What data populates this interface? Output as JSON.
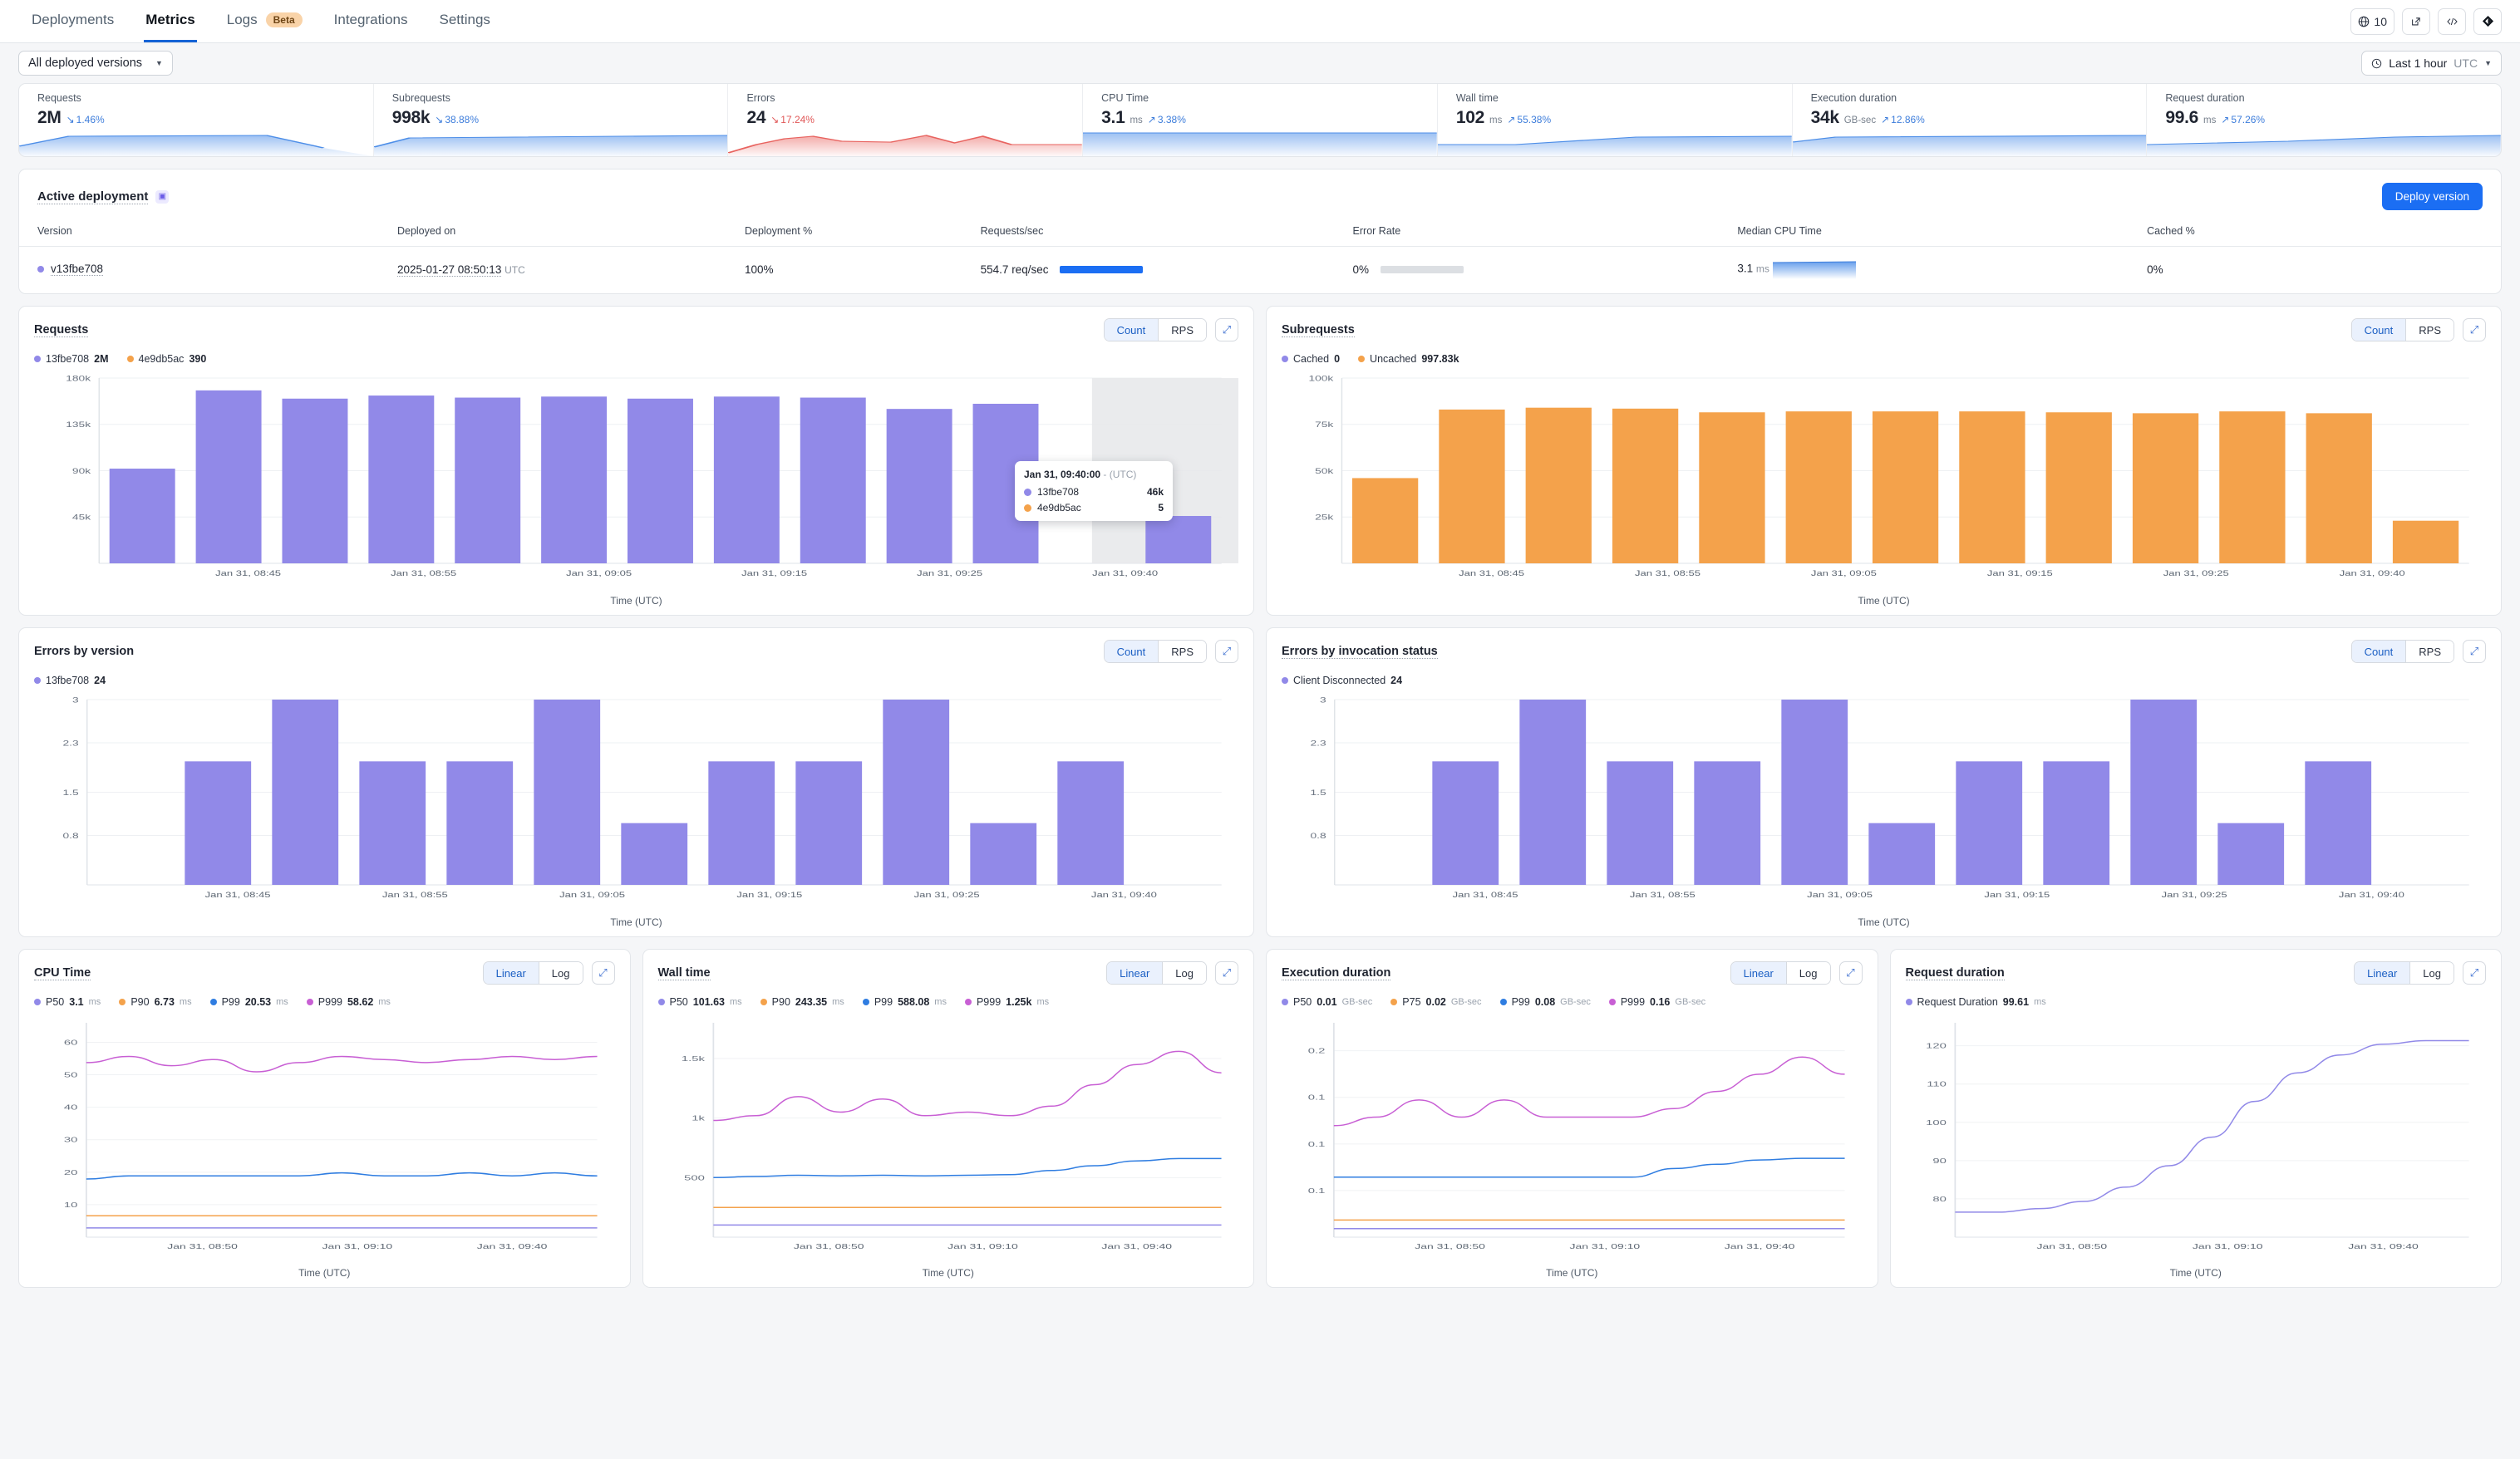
{
  "nav": {
    "items": [
      {
        "label": "Deployments",
        "active": false
      },
      {
        "label": "Metrics",
        "active": true
      },
      {
        "label": "Logs",
        "badge": "Beta",
        "active": false
      },
      {
        "label": "Integrations",
        "active": false
      },
      {
        "label": "Settings",
        "active": false
      }
    ],
    "globe_count": "10"
  },
  "filters": {
    "version_select": "All deployed versions",
    "time_range": "Last 1 hour",
    "time_zone": "UTC"
  },
  "kpis": [
    {
      "label": "Requests",
      "value": "2M",
      "unit": "",
      "delta": "1.46%",
      "dir": "down",
      "tone": "blue"
    },
    {
      "label": "Subrequests",
      "value": "998k",
      "unit": "",
      "delta": "38.88%",
      "dir": "down",
      "tone": "blue"
    },
    {
      "label": "Errors",
      "value": "24",
      "unit": "",
      "delta": "17.24%",
      "dir": "down",
      "tone": "red"
    },
    {
      "label": "CPU Time",
      "value": "3.1",
      "unit": "ms",
      "delta": "3.38%",
      "dir": "up",
      "tone": "blue"
    },
    {
      "label": "Wall time",
      "value": "102",
      "unit": "ms",
      "delta": "55.38%",
      "dir": "up",
      "tone": "blue"
    },
    {
      "label": "Execution duration",
      "value": "34k",
      "unit": "GB-sec",
      "delta": "12.86%",
      "dir": "up",
      "tone": "blue"
    },
    {
      "label": "Request duration",
      "value": "99.6",
      "unit": "ms",
      "delta": "57.26%",
      "dir": "up",
      "tone": "blue"
    }
  ],
  "active_deployment": {
    "title": "Active deployment",
    "deploy_button": "Deploy version",
    "columns": [
      "Version",
      "Deployed on",
      "Deployment %",
      "Requests/sec",
      "Error Rate",
      "Median CPU Time",
      "Cached %"
    ],
    "row": {
      "version": "v13fbe708",
      "deployed_on": "2025-01-27 08:50:13",
      "deployed_on_tz": "UTC",
      "deployment_pct": "100%",
      "requests_sec": "554.7 req/sec",
      "error_rate": "0%",
      "median_cpu_time": "3.1",
      "median_cpu_unit": "ms",
      "cached_pct": "0%"
    }
  },
  "colors": {
    "purple": "#9189e8",
    "orange": "#f4a24b",
    "blue": "#2f7de1",
    "magenta": "#c85fd4",
    "accent": "#1b6ef3"
  },
  "charts": {
    "requests": {
      "title": "Requests",
      "toggle": [
        "Count",
        "RPS"
      ],
      "toggle_active": "Count",
      "legend": [
        {
          "name": "13fbe708",
          "value": "2M",
          "color": "#9189e8"
        },
        {
          "name": "4e9db5ac",
          "value": "390",
          "color": "#f4a24b"
        }
      ],
      "xlabel": "Time (UTC)",
      "tooltip": {
        "time": "Jan 31, 09:40:00",
        "dash": "-",
        "tz": "(UTC)",
        "rows": [
          {
            "name": "13fbe708",
            "value": "46k",
            "color": "#9189e8"
          },
          {
            "name": "4e9db5ac",
            "value": "5",
            "color": "#f4a24b"
          }
        ]
      }
    },
    "subrequests": {
      "title": "Subrequests",
      "toggle": [
        "Count",
        "RPS"
      ],
      "toggle_active": "Count",
      "legend": [
        {
          "name": "Cached",
          "value": "0",
          "color": "#9189e8"
        },
        {
          "name": "Uncached",
          "value": "997.83k",
          "color": "#f4a24b"
        }
      ],
      "xlabel": "Time (UTC)"
    },
    "errors_by_version": {
      "title": "Errors by version",
      "toggle": [
        "Count",
        "RPS"
      ],
      "toggle_active": "Count",
      "legend": [
        {
          "name": "13fbe708",
          "value": "24",
          "color": "#9189e8"
        }
      ],
      "xlabel": "Time (UTC)"
    },
    "errors_by_status": {
      "title": "Errors by invocation status",
      "toggle": [
        "Count",
        "RPS"
      ],
      "toggle_active": "Count",
      "legend": [
        {
          "name": "Client Disconnected",
          "value": "24",
          "color": "#9189e8"
        }
      ],
      "xlabel": "Time (UTC)"
    },
    "cpu_time": {
      "title": "CPU Time",
      "toggle": [
        "Linear",
        "Log"
      ],
      "toggle_active": "Linear",
      "legend": [
        {
          "name": "P50",
          "value": "3.1",
          "unit": "ms",
          "color": "#9189e8"
        },
        {
          "name": "P90",
          "value": "6.73",
          "unit": "ms",
          "color": "#f4a24b"
        },
        {
          "name": "P99",
          "value": "20.53",
          "unit": "ms",
          "color": "#2f7de1"
        },
        {
          "name": "P999",
          "value": "58.62",
          "unit": "ms",
          "color": "#c85fd4"
        }
      ],
      "xlabel": "Time (UTC)"
    },
    "wall_time": {
      "title": "Wall time",
      "toggle": [
        "Linear",
        "Log"
      ],
      "toggle_active": "Linear",
      "legend": [
        {
          "name": "P50",
          "value": "101.63",
          "unit": "ms",
          "color": "#9189e8"
        },
        {
          "name": "P90",
          "value": "243.35",
          "unit": "ms",
          "color": "#f4a24b"
        },
        {
          "name": "P99",
          "value": "588.08",
          "unit": "ms",
          "color": "#2f7de1"
        },
        {
          "name": "P999",
          "value": "1.25k",
          "unit": "ms",
          "color": "#c85fd4"
        }
      ],
      "xlabel": "Time (UTC)"
    },
    "execution_duration": {
      "title": "Execution duration",
      "toggle": [
        "Linear",
        "Log"
      ],
      "toggle_active": "Linear",
      "legend": [
        {
          "name": "P50",
          "value": "0.01",
          "unit": "GB-sec",
          "color": "#9189e8"
        },
        {
          "name": "P75",
          "value": "0.02",
          "unit": "GB-sec",
          "color": "#f4a24b"
        },
        {
          "name": "P99",
          "value": "0.08",
          "unit": "GB-sec",
          "color": "#2f7de1"
        },
        {
          "name": "P999",
          "value": "0.16",
          "unit": "GB-sec",
          "color": "#c85fd4"
        }
      ],
      "xlabel": "Time (UTC)"
    },
    "request_duration": {
      "title": "Request duration",
      "toggle": [
        "Linear",
        "Log"
      ],
      "toggle_active": "Linear",
      "legend": [
        {
          "name": "Request Duration",
          "value": "99.61",
          "unit": "ms",
          "color": "#9189e8"
        }
      ],
      "xlabel": "Time (UTC)"
    }
  },
  "chart_data": [
    {
      "type": "bar",
      "name": "requests",
      "title": "Requests",
      "xlabel": "Time (UTC)",
      "ylabel": "",
      "ylim": [
        0,
        180000
      ],
      "yticks": [
        "45k",
        "90k",
        "135k",
        "180k"
      ],
      "ytick_values": [
        45000,
        90000,
        135000,
        180000
      ],
      "xticks": [
        "Jan 31, 08:45",
        "Jan 31, 08:55",
        "Jan 31, 09:05",
        "Jan 31, 09:15",
        "Jan 31, 09:25",
        "Jan 31, 09:40"
      ],
      "categories": [
        "08:40",
        "08:45",
        "08:50",
        "08:55",
        "09:00",
        "09:05",
        "09:10",
        "09:15",
        "09:20",
        "09:25",
        "09:30",
        "09:35",
        "09:40"
      ],
      "series": [
        {
          "name": "13fbe708",
          "color": "#9189e8",
          "values": [
            92000,
            168000,
            160000,
            163000,
            161000,
            162000,
            160000,
            162000,
            161000,
            150000,
            155000,
            0,
            46000
          ]
        },
        {
          "name": "4e9db5ac",
          "color": "#f4a24b",
          "values": [
            0,
            0,
            0,
            0,
            0,
            0,
            0,
            0,
            0,
            0,
            0,
            0,
            5
          ]
        }
      ],
      "total_labels": {
        "13fbe708": "2M",
        "4e9db5ac": "390"
      }
    },
    {
      "type": "bar",
      "name": "subrequests",
      "title": "Subrequests",
      "xlabel": "Time (UTC)",
      "ylim": [
        0,
        100000
      ],
      "yticks": [
        "25k",
        "50k",
        "75k",
        "100k"
      ],
      "ytick_values": [
        25000,
        50000,
        75000,
        100000
      ],
      "xticks": [
        "Jan 31, 08:45",
        "Jan 31, 08:55",
        "Jan 31, 09:05",
        "Jan 31, 09:15",
        "Jan 31, 09:25",
        "Jan 31, 09:40"
      ],
      "categories": [
        "08:40",
        "08:45",
        "08:50",
        "08:55",
        "09:00",
        "09:05",
        "09:10",
        "09:15",
        "09:20",
        "09:25",
        "09:30",
        "09:35",
        "09:40"
      ],
      "series": [
        {
          "name": "Cached",
          "color": "#9189e8",
          "values": [
            0,
            0,
            0,
            0,
            0,
            0,
            0,
            0,
            0,
            0,
            0,
            0,
            0
          ]
        },
        {
          "name": "Uncached",
          "color": "#f4a24b",
          "values": [
            46000,
            83000,
            84000,
            83500,
            81500,
            82000,
            82000,
            82000,
            81500,
            81000,
            82000,
            81000,
            23000
          ]
        }
      ]
    },
    {
      "type": "bar",
      "name": "errors_by_version",
      "title": "Errors by version",
      "xlabel": "Time (UTC)",
      "ylim": [
        0,
        3
      ],
      "yticks": [
        "0.8",
        "1.5",
        "2.3",
        "3"
      ],
      "ytick_values": [
        0.8,
        1.5,
        2.3,
        3
      ],
      "xticks": [
        "Jan 31, 08:45",
        "Jan 31, 08:55",
        "Jan 31, 09:05",
        "Jan 31, 09:15",
        "Jan 31, 09:25",
        "Jan 31, 09:40"
      ],
      "categories": [
        "08:40",
        "08:45",
        "08:50",
        "08:55",
        "09:00",
        "09:05",
        "09:10",
        "09:15",
        "09:20",
        "09:25",
        "09:30",
        "09:35",
        "09:40"
      ],
      "series": [
        {
          "name": "13fbe708",
          "color": "#9189e8",
          "values": [
            0,
            2,
            3,
            2,
            2,
            3,
            1,
            2,
            2,
            3,
            1,
            2,
            0
          ]
        }
      ]
    },
    {
      "type": "bar",
      "name": "errors_by_invocation_status",
      "title": "Errors by invocation status",
      "xlabel": "Time (UTC)",
      "ylim": [
        0,
        3
      ],
      "yticks": [
        "0.8",
        "1.5",
        "2.3",
        "3"
      ],
      "ytick_values": [
        0.8,
        1.5,
        2.3,
        3
      ],
      "xticks": [
        "Jan 31, 08:45",
        "Jan 31, 08:55",
        "Jan 31, 09:05",
        "Jan 31, 09:15",
        "Jan 31, 09:25",
        "Jan 31, 09:40"
      ],
      "categories": [
        "08:40",
        "08:45",
        "08:50",
        "08:55",
        "09:00",
        "09:05",
        "09:10",
        "09:15",
        "09:20",
        "09:25",
        "09:30",
        "09:35",
        "09:40"
      ],
      "series": [
        {
          "name": "Client Disconnected",
          "color": "#9189e8",
          "values": [
            0,
            2,
            3,
            2,
            2,
            3,
            1,
            2,
            2,
            3,
            1,
            2,
            0
          ]
        }
      ]
    },
    {
      "type": "line",
      "name": "cpu_time",
      "title": "CPU Time",
      "xlabel": "Time (UTC)",
      "ylim": [
        0,
        70
      ],
      "yticks": [
        "10",
        "20",
        "30",
        "40",
        "50",
        "60"
      ],
      "xticks": [
        "Jan 31, 08:50",
        "Jan 31, 09:10",
        "Jan 31, 09:40"
      ],
      "series": [
        {
          "name": "P999",
          "color": "#c85fd4",
          "values": [
            57,
            59,
            56,
            58,
            54,
            57,
            59,
            58,
            57,
            58,
            59,
            58,
            59
          ]
        },
        {
          "name": "P99",
          "color": "#2f7de1",
          "values": [
            19,
            20,
            20,
            20,
            20,
            20,
            21,
            20,
            20,
            21,
            20,
            21,
            20
          ]
        },
        {
          "name": "P90",
          "color": "#f4a24b",
          "values": [
            7,
            7,
            7,
            7,
            7,
            7,
            7,
            7,
            7,
            7,
            7,
            7,
            7
          ]
        },
        {
          "name": "P50",
          "color": "#9189e8",
          "values": [
            3,
            3,
            3,
            3,
            3,
            3,
            3,
            3,
            3,
            3,
            3,
            3,
            3
          ]
        }
      ]
    },
    {
      "type": "line",
      "name": "wall_time",
      "title": "Wall time",
      "xlabel": "Time (UTC)",
      "ylim": [
        0,
        1800
      ],
      "yticks": [
        "500",
        "1k",
        "1.5k"
      ],
      "xticks": [
        "Jan 31, 08:50",
        "Jan 31, 09:10",
        "Jan 31, 09:40"
      ],
      "series": [
        {
          "name": "P999",
          "color": "#c85fd4",
          "values": [
            980,
            1020,
            1180,
            1050,
            1160,
            1020,
            1050,
            1020,
            1100,
            1280,
            1450,
            1560,
            1380
          ]
        },
        {
          "name": "P99",
          "color": "#2f7de1",
          "values": [
            500,
            510,
            520,
            515,
            520,
            515,
            520,
            525,
            560,
            600,
            640,
            660,
            660
          ]
        },
        {
          "name": "P90",
          "color": "#f4a24b",
          "values": [
            250,
            250,
            250,
            250,
            250,
            250,
            250,
            250,
            250,
            250,
            250,
            250,
            250
          ]
        },
        {
          "name": "P50",
          "color": "#9189e8",
          "values": [
            102,
            102,
            102,
            102,
            102,
            102,
            102,
            102,
            102,
            102,
            102,
            102,
            102
          ]
        }
      ]
    },
    {
      "type": "line",
      "name": "execution_duration",
      "title": "Execution duration",
      "xlabel": "Time (UTC)",
      "ylim": [
        0,
        0.25
      ],
      "yticks": [
        "0.1",
        "0.1",
        "0.1",
        "0.2"
      ],
      "xticks": [
        "Jan 31, 08:50",
        "Jan 31, 09:10",
        "Jan 31, 09:40"
      ],
      "series": [
        {
          "name": "P999",
          "color": "#c85fd4",
          "values": [
            0.13,
            0.14,
            0.16,
            0.14,
            0.16,
            0.14,
            0.14,
            0.14,
            0.15,
            0.17,
            0.19,
            0.21,
            0.19
          ]
        },
        {
          "name": "P99",
          "color": "#2f7de1",
          "values": [
            0.07,
            0.07,
            0.07,
            0.07,
            0.07,
            0.07,
            0.07,
            0.07,
            0.08,
            0.085,
            0.09,
            0.092,
            0.092
          ]
        },
        {
          "name": "P75",
          "color": "#f4a24b",
          "values": [
            0.02,
            0.02,
            0.02,
            0.02,
            0.02,
            0.02,
            0.02,
            0.02,
            0.02,
            0.02,
            0.02,
            0.02,
            0.02
          ]
        },
        {
          "name": "P50",
          "color": "#9189e8",
          "values": [
            0.01,
            0.01,
            0.01,
            0.01,
            0.01,
            0.01,
            0.01,
            0.01,
            0.01,
            0.01,
            0.01,
            0.01,
            0.01
          ]
        }
      ]
    },
    {
      "type": "line",
      "name": "request_duration",
      "title": "Request duration",
      "xlabel": "Time (UTC)",
      "ylim": [
        70,
        130
      ],
      "yticks": [
        "80",
        "90",
        "100",
        "110",
        "120"
      ],
      "xticks": [
        "Jan 31, 08:50",
        "Jan 31, 09:10",
        "Jan 31, 09:40"
      ],
      "series": [
        {
          "name": "Request Duration",
          "color": "#9189e8",
          "values": [
            77,
            77,
            78,
            80,
            84,
            90,
            98,
            108,
            116,
            121,
            124,
            125,
            125
          ]
        }
      ]
    }
  ]
}
